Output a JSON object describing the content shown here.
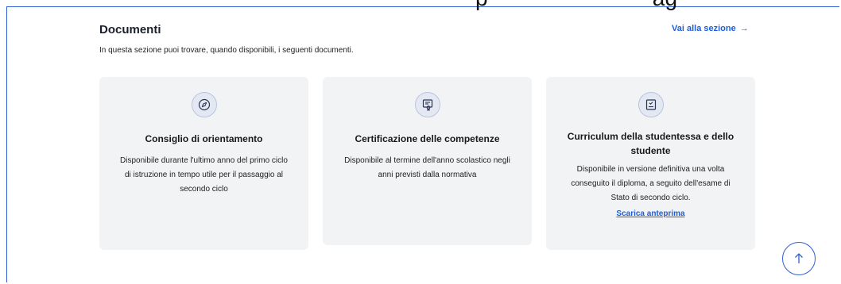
{
  "overflow_text": "p",
  "overflow_text_right": "ag",
  "section": {
    "title": "Documenti",
    "description": "In questa sezione puoi trovare, quando disponibili, i seguenti documenti.",
    "link_label": "Vai alla sezione",
    "link_arrow": "→"
  },
  "cards": [
    {
      "icon": "compass-icon",
      "title": "Consiglio di orientamento",
      "description": "Disponibile durante l'ultimo anno del primo ciclo di istruzione in tempo utile per il passaggio al secondo ciclo"
    },
    {
      "icon": "certificate-icon",
      "title": "Certificazione delle competenze",
      "description": "Disponibile al termine dell'anno scolastico negli anni previsti dalla normativa"
    },
    {
      "icon": "checklist-document-icon",
      "title": "Curriculum della studentessa e dello studente",
      "description": "Disponibile in versione definitiva una volta conseguito il diploma, a seguito dell'esame di Stato di secondo ciclo.",
      "cta_label": "Scarica anteprima"
    }
  ],
  "scroll_top": {
    "icon": "arrow-up-icon"
  },
  "colors": {
    "accent": "#1f5ed8",
    "card_bg": "#f2f3f5",
    "border": "#2f5fd0"
  }
}
